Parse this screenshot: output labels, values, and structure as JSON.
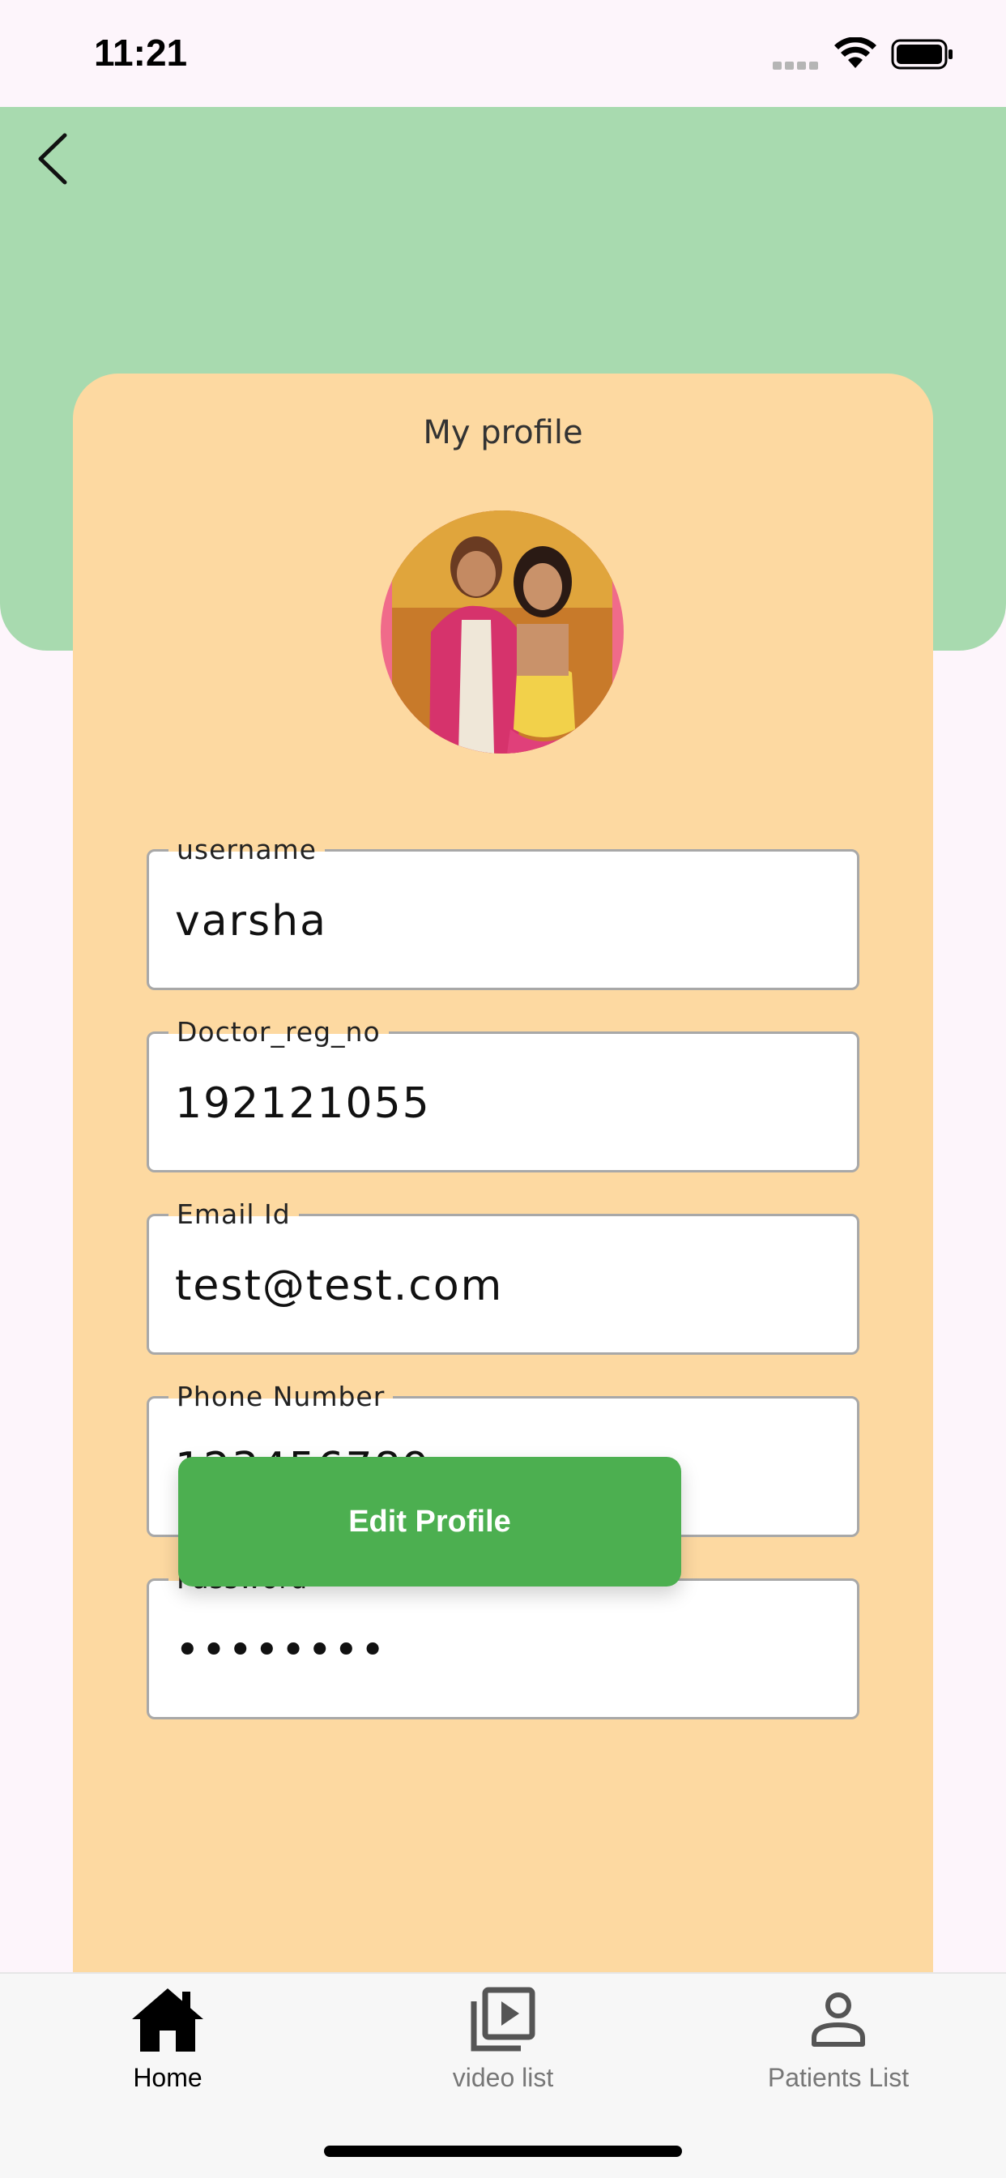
{
  "status_bar": {
    "time": "11:21"
  },
  "header": {
    "back_icon": "chevron-left-icon"
  },
  "card": {
    "title": "My profile",
    "fields": [
      {
        "label": "username",
        "value": "varsha"
      },
      {
        "label": "Doctor_reg_no",
        "value": "192121055"
      },
      {
        "label": "Email Id",
        "value": "test@test.com"
      },
      {
        "label": "Phone Number",
        "value": "123456789"
      },
      {
        "label": "Password",
        "value": "••••••••"
      }
    ],
    "edit_button": "Edit Profile"
  },
  "bottom_nav": {
    "items": [
      {
        "label": "Home",
        "icon": "home-icon",
        "active": true
      },
      {
        "label": "video list",
        "icon": "video-library-icon",
        "active": false
      },
      {
        "label": "Patients List",
        "icon": "person-icon",
        "active": false
      }
    ]
  },
  "colors": {
    "header_bg": "#a8daaf",
    "card_bg": "#fdd9a1",
    "button_green": "#4caf50",
    "page_bg": "#fdf5fb"
  }
}
